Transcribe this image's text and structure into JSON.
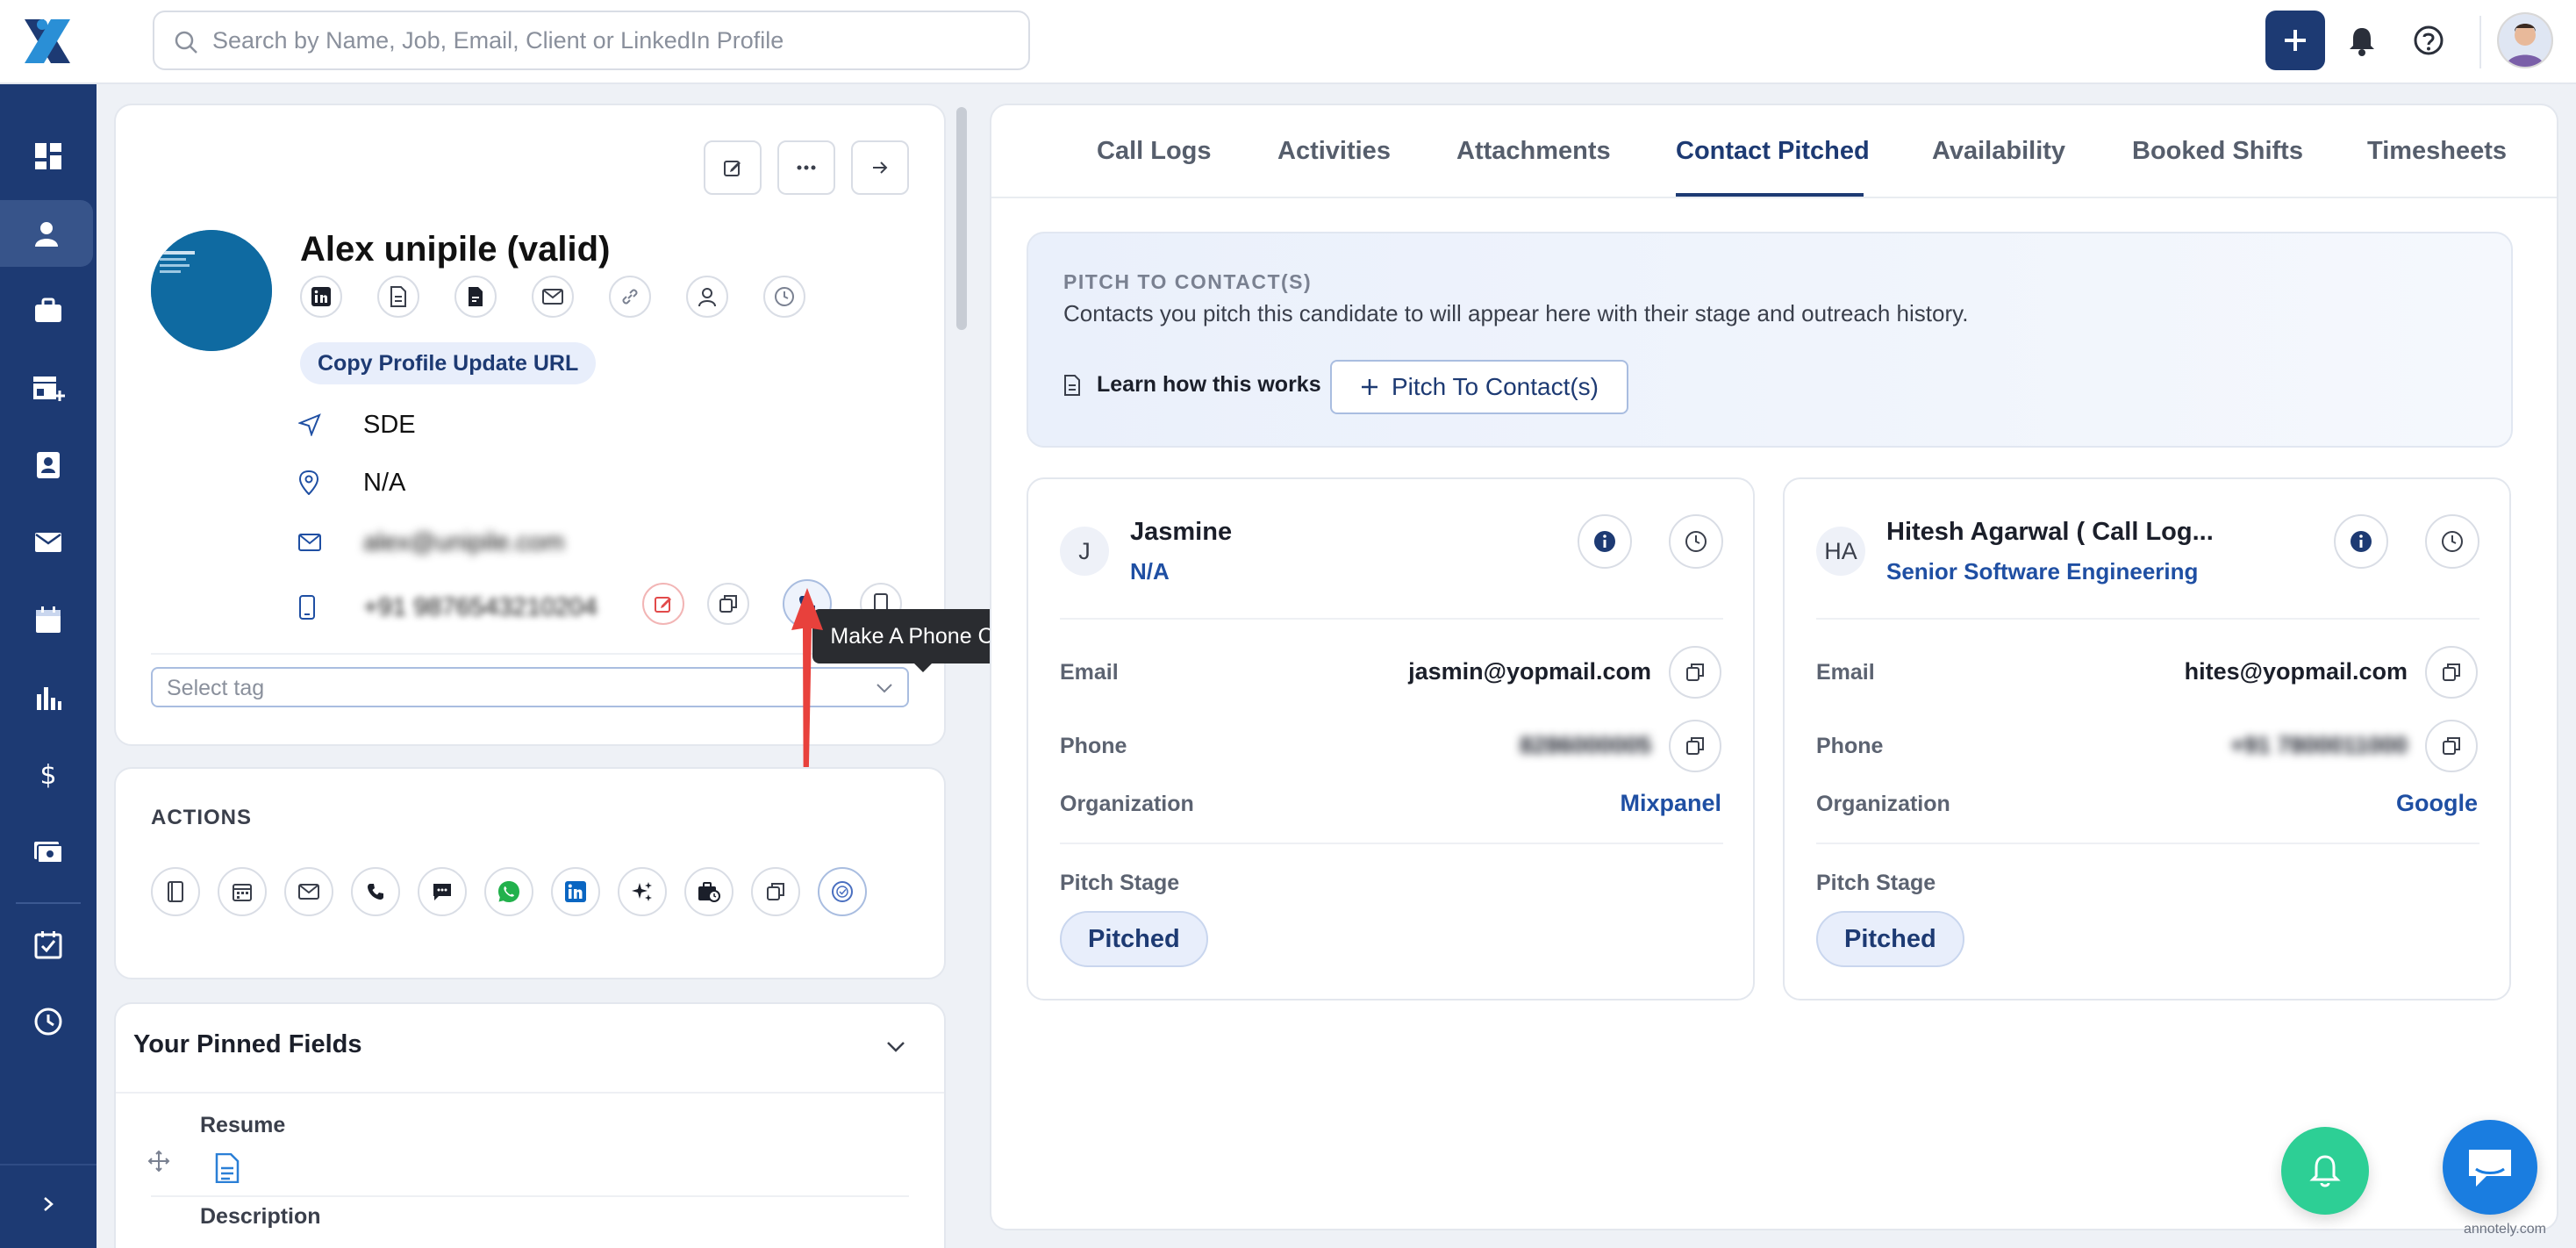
{
  "search": {
    "placeholder": "Search by Name, Job, Email, Client or LinkedIn Profile"
  },
  "profile": {
    "name": "Alex unipile (valid)",
    "copy_url_label": "Copy Profile Update URL",
    "job": "SDE",
    "location": "N/A",
    "email_masked": "alex@unipile.com",
    "phone_masked": "+91 9876543210204",
    "tag_placeholder": "Select tag",
    "photo_text": "SCHEDULE"
  },
  "tooltip": {
    "text": "Make A Phone Call"
  },
  "actions": {
    "title": "ACTIONS"
  },
  "pinned": {
    "title": "Your Pinned Fields",
    "fields": [
      "Resume",
      "Description"
    ]
  },
  "tabs": [
    {
      "label": "Call Logs"
    },
    {
      "label": "Activities"
    },
    {
      "label": "Attachments"
    },
    {
      "label": "Contact Pitched"
    },
    {
      "label": "Availability"
    },
    {
      "label": "Booked Shifts"
    },
    {
      "label": "Timesheets"
    }
  ],
  "active_tab": "Contact Pitched",
  "pitch": {
    "heading": "PITCH TO CONTACT(S)",
    "subtext": "Contacts you pitch this candidate to will appear here with their stage and outreach history.",
    "learn_label": "Learn how this works",
    "button_label": "Pitch To Contact(s)"
  },
  "contacts": [
    {
      "initials": "J",
      "name": "Jasmine",
      "title": "N/A",
      "email_label": "Email",
      "email": "jasmin@yopmail.com",
      "phone_label": "Phone",
      "phone_masked": "8286000005",
      "org_label": "Organization",
      "org": "Mixpanel",
      "stage_label": "Pitch Stage",
      "stage": "Pitched"
    },
    {
      "initials": "HA",
      "name": "Hitesh Agarwal ( Call Log...",
      "title": "Senior Software Engineering",
      "email_label": "Email",
      "email": "hites@yopmail.com",
      "phone_label": "Phone",
      "phone_masked": "+91 7800011000",
      "org_label": "Organization",
      "org": "Google",
      "stage_label": "Pitch Stage",
      "stage": "Pitched"
    }
  ],
  "watermark": "annotely.com",
  "colors": {
    "brand": "#1d3a73",
    "link": "#1f4fa3",
    "fab_bell": "#2dcf95",
    "fab_chat": "#1a7de0",
    "arrow": "#e8413c"
  }
}
